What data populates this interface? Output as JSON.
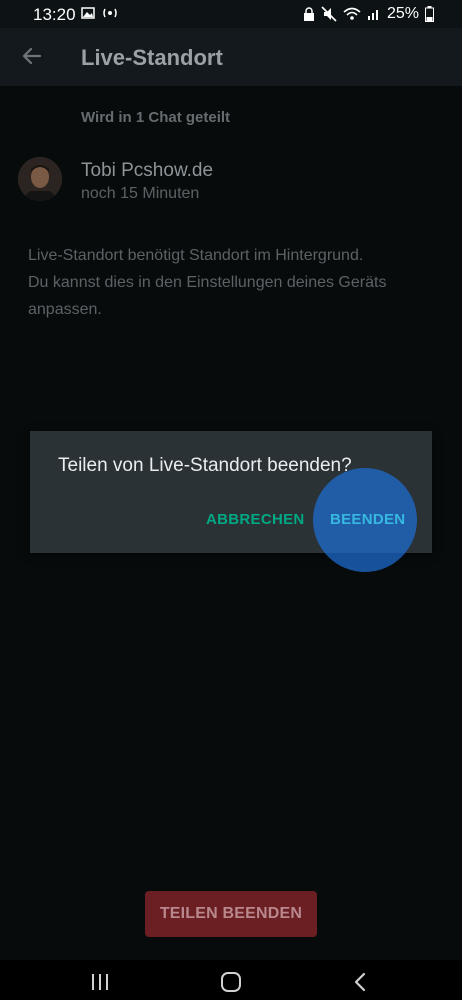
{
  "status_bar": {
    "time": "13:20",
    "battery": "25%",
    "icons": [
      "image-icon",
      "nfc-icon",
      "lock-icon",
      "mute-icon",
      "wifi-icon",
      "signal-icon",
      "battery-icon"
    ]
  },
  "app_bar": {
    "title": "Live-Standort",
    "back_icon": "arrow-back-icon"
  },
  "content": {
    "section_header": "Wird in 1 Chat geteilt",
    "contact": {
      "name": "Tobi Pcshow.de",
      "subtitle": "noch 15 Minuten"
    },
    "info_lines": [
      "Live-Standort benötigt Standort im Hintergrund.",
      "Du kannst dies in den Einstellungen deines Geräts",
      "anpassen."
    ]
  },
  "dialog": {
    "title": "Teilen von Live-Standort beenden?",
    "cancel_label": "ABBRECHEN",
    "confirm_label": "BEENDEN"
  },
  "bottom_button": {
    "label": "TEILEN BEENDEN"
  },
  "nav_bar": {
    "items": [
      "recents-icon",
      "home-icon",
      "back-icon"
    ]
  },
  "colors": {
    "accent": "#00a884",
    "danger": "#6b1f23",
    "dialog_bg": "#2a3236"
  }
}
